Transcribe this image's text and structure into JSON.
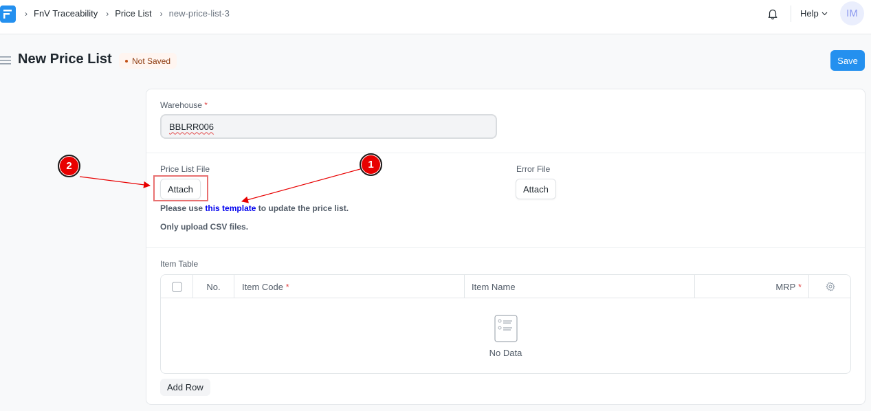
{
  "navbar": {
    "breadcrumbs": [
      "FnV Traceability",
      "Price List",
      "new-price-list-3"
    ],
    "help_label": "Help",
    "avatar_initials": "IM"
  },
  "page": {
    "title": "New Price List",
    "status": "Not Saved",
    "save_label": "Save"
  },
  "form": {
    "warehouse_label": "Warehouse",
    "warehouse_value": "BBLRR006",
    "required_mark": "*",
    "price_list_file_label": "Price List File",
    "price_list_attach_label": "Attach",
    "error_file_label": "Error File",
    "error_attach_label": "Attach",
    "help_prefix": "Please use ",
    "help_link": "this template",
    "help_suffix": " to update the price list.",
    "csv_note": "Only upload CSV files."
  },
  "item_table": {
    "label": "Item Table",
    "columns": [
      "No.",
      "Item Code",
      "Item Name",
      "MRP"
    ],
    "empty_text": "No Data",
    "add_row_label": "Add Row"
  },
  "annotations": [
    "1",
    "2"
  ],
  "colors": {
    "primary": "#2490ef",
    "annotation_red": "#e80000",
    "link_blue": "#0000ee"
  }
}
